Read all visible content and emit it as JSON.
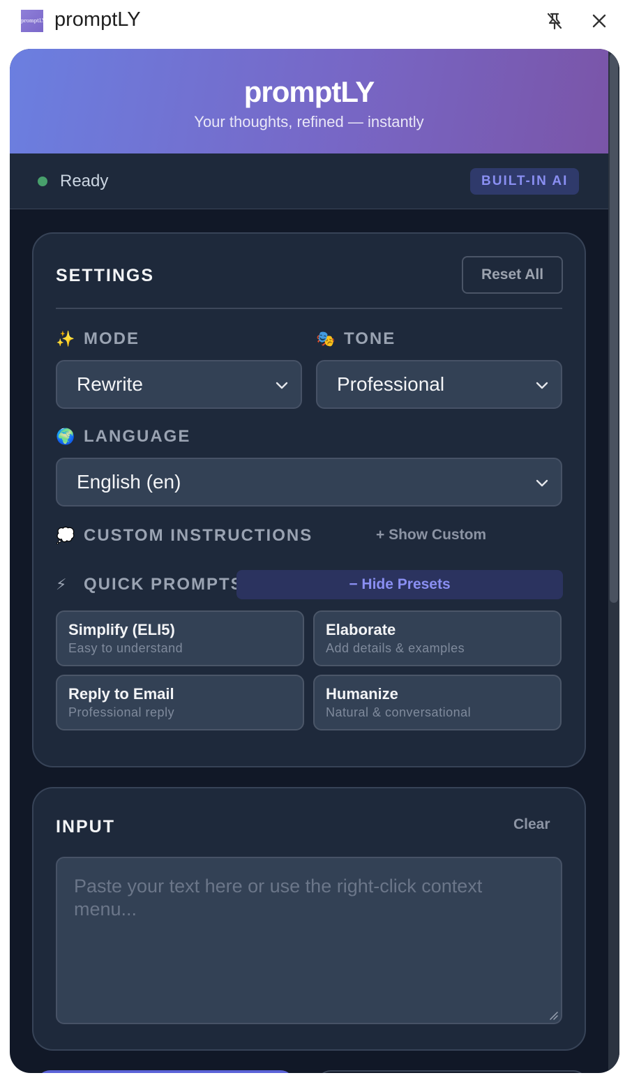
{
  "window": {
    "app_name": "promptLY",
    "logo_text": "promptLY"
  },
  "header": {
    "title": "promptLY",
    "subtitle": "Your thoughts, refined — instantly"
  },
  "status": {
    "text": "Ready",
    "badge": "BUILT-IN AI"
  },
  "settings": {
    "title": "SETTINGS",
    "reset_label": "Reset All",
    "mode": {
      "label": "MODE",
      "emoji": "✨",
      "value": "Rewrite"
    },
    "tone": {
      "label": "TONE",
      "emoji": "🎭",
      "value": "Professional"
    },
    "language": {
      "label": "LANGUAGE",
      "emoji": "🌍",
      "value": "English (en)"
    },
    "custom": {
      "label": "CUSTOM INSTRUCTIONS",
      "emoji": "💭",
      "toggle": "+ Show Custom"
    },
    "quick": {
      "label": "QUICK PROMPTS",
      "emoji": "⚡",
      "toggle": "− Hide Presets"
    },
    "presets": [
      {
        "title": "Simplify (ELI5)",
        "sub": "Easy to understand"
      },
      {
        "title": "Elaborate",
        "sub": "Add details & examples"
      },
      {
        "title": "Reply to Email",
        "sub": "Professional reply"
      },
      {
        "title": "Humanize",
        "sub": "Natural & conversational"
      }
    ]
  },
  "input": {
    "title": "INPUT",
    "clear_label": "Clear",
    "placeholder": "Paste your text here or use the right-click context menu..."
  },
  "colors": {
    "accent": "#8a8ff2",
    "status_dot": "#48a06c",
    "panel_bg": "#111827",
    "card_bg": "#1e293b"
  }
}
